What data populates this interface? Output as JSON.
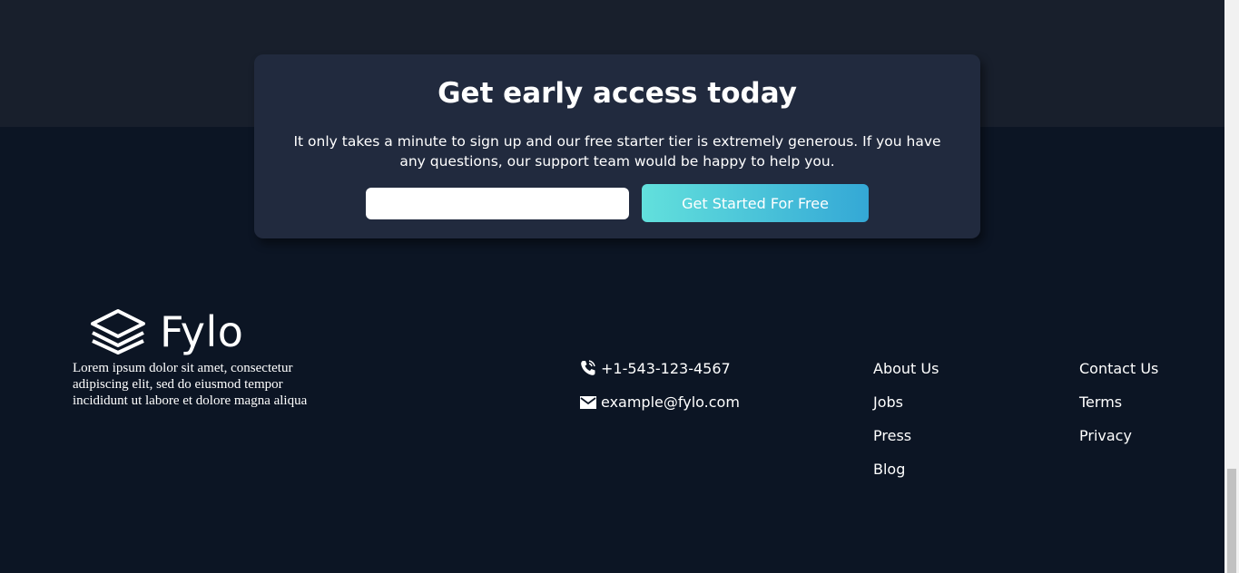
{
  "cta": {
    "title": "Get early access today",
    "description": "It only takes a minute to sign up and our free starter tier is extremely generous. If you have any questions, our support team would be happy to help you.",
    "email_value": "",
    "email_placeholder": "",
    "button_label": "Get Started For Free"
  },
  "footer": {
    "brand": "Fylo",
    "description": "Lorem ipsum dolor sit amet, consectetur adipiscing elit, sed do eiusmod tempor incididunt ut labore et dolore magna aliqua",
    "phone": "+1-543-123-4567",
    "email": "example@fylo.com",
    "links_col1": [
      "About Us",
      "Jobs",
      "Press",
      "Blog"
    ],
    "links_col2": [
      "Contact Us",
      "Terms",
      "Privacy"
    ]
  },
  "colors": {
    "accent_start": "#62e0dc",
    "accent_end": "#34a8d6",
    "card_background": "#212a3e",
    "page_background": "#0c1524"
  },
  "icons": {
    "logo": "stacked-layers-icon",
    "phone": "phone-icon",
    "email": "envelope-icon"
  }
}
